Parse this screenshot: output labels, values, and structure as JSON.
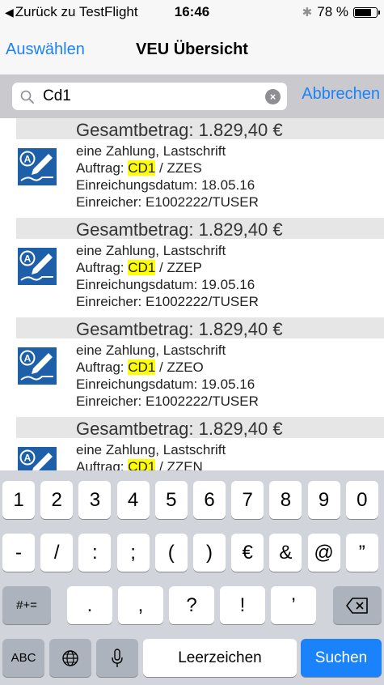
{
  "status_bar": {
    "back_label": "Zurück zu TestFlight",
    "time": "16:46",
    "battery_text": "78 %",
    "battery_level": 0.78,
    "bluetooth_icon": "bluetooth-icon"
  },
  "nav": {
    "left_button": "Auswählen",
    "title": "VEU Übersicht"
  },
  "search": {
    "value": "Cd1",
    "cancel_label": "Abbrechen",
    "search_icon": "search-icon",
    "clear_icon": "clear-icon"
  },
  "items": [
    {
      "total": "Gesamtbetrag: 1.829,40 €",
      "line1": "eine Zahlung, Lastschrift",
      "auftrag_prefix": "Auftrag: ",
      "auftrag_hl": "CD1",
      "auftrag_suffix": " / ZZES",
      "datum": "Einreichungsdatum: 18.05.16",
      "einreicher": "Einreicher: E1002222/TUSER"
    },
    {
      "total": "Gesamtbetrag: 1.829,40 €",
      "line1": "eine Zahlung, Lastschrift",
      "auftrag_prefix": "Auftrag: ",
      "auftrag_hl": "CD1",
      "auftrag_suffix": " / ZZEP",
      "datum": "Einreichungsdatum: 19.05.16",
      "einreicher": "Einreicher: E1002222/TUSER"
    },
    {
      "total": "Gesamtbetrag: 1.829,40 €",
      "line1": "eine Zahlung, Lastschrift",
      "auftrag_prefix": "Auftrag: ",
      "auftrag_hl": "CD1",
      "auftrag_suffix": " / ZZEO",
      "datum": "Einreichungsdatum: 19.05.16",
      "einreicher": "Einreicher: E1002222/TUSER"
    },
    {
      "total": "Gesamtbetrag: 1.829,40 €",
      "line1": "eine Zahlung, Lastschrift",
      "auftrag_prefix": "Auftrag: ",
      "auftrag_hl": "CD1",
      "auftrag_suffix": " / ZZEN"
    }
  ],
  "keyboard": {
    "row1": [
      "1",
      "2",
      "3",
      "4",
      "5",
      "6",
      "7",
      "8",
      "9",
      "0"
    ],
    "row2": [
      "-",
      "/",
      ":",
      ";",
      "(",
      ")",
      "€",
      "&",
      "@",
      "”"
    ],
    "row3_left": "#+=",
    "row3": [
      ".",
      ",",
      "?",
      "!",
      "’"
    ],
    "row4_abc": "ABC",
    "space_label": "Leerzeichen",
    "return_label": "Suchen"
  },
  "colors": {
    "accent": "#1a82fb",
    "icon_bg": "#1d5fa8",
    "highlight": "#ffff00"
  }
}
